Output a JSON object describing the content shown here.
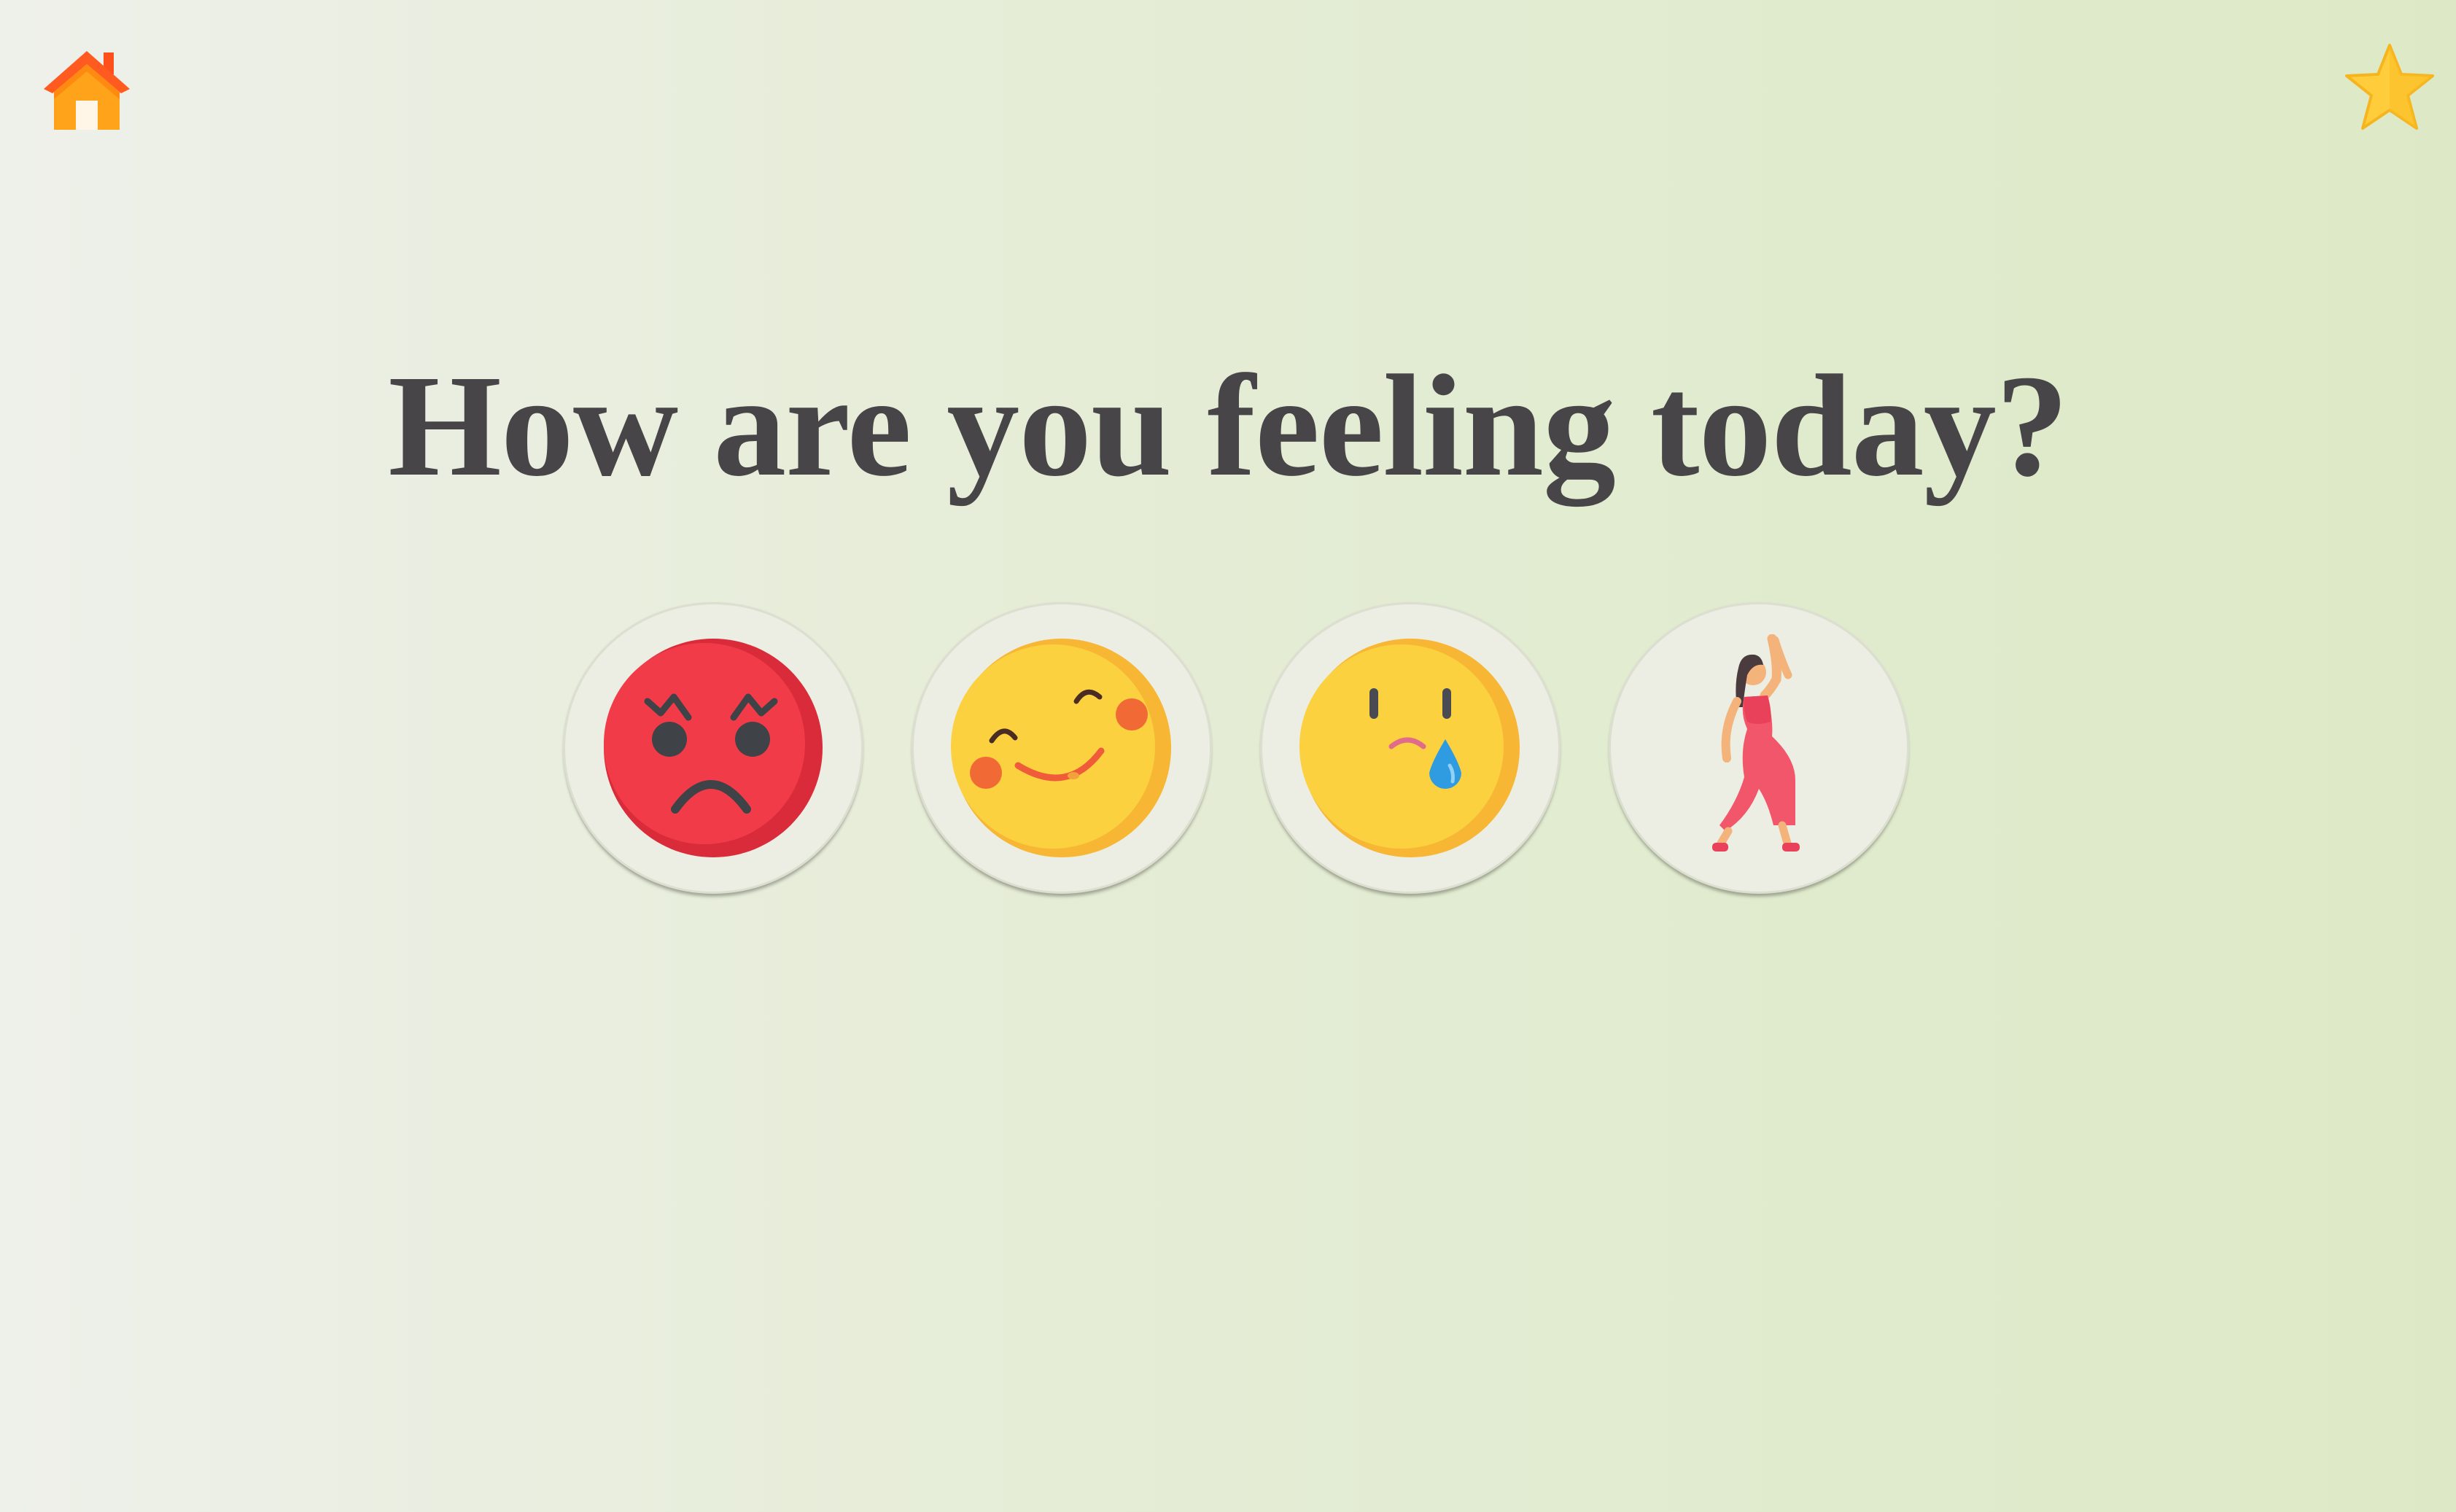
{
  "header": {
    "home_icon": "home-icon",
    "favorite_icon": "star-icon"
  },
  "prompt": {
    "title": "How are you feeling today?"
  },
  "moods": [
    {
      "icon": "angry-face-icon",
      "color": "#f23b48"
    },
    {
      "icon": "happy-wink-face-icon",
      "color": "#fbd140"
    },
    {
      "icon": "crying-face-icon",
      "color": "#fbd140"
    },
    {
      "icon": "dancing-woman-icon",
      "color": "#f2566a"
    }
  ],
  "colors": {
    "title": "#474548",
    "home": "#ff9f1a",
    "star": "#ffcb3d"
  }
}
